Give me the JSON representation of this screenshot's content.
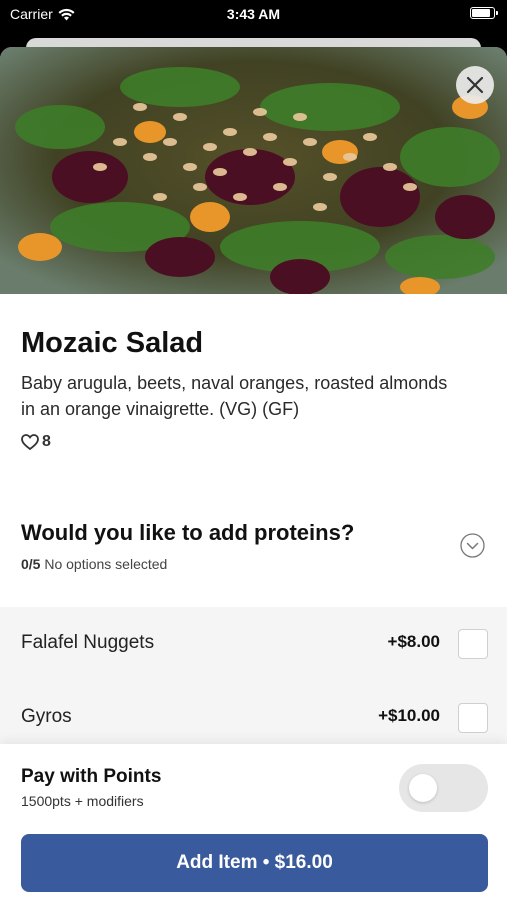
{
  "status_bar": {
    "carrier": "Carrier",
    "time": "3:43 AM"
  },
  "item": {
    "name": "Mozaic Salad",
    "description": "Baby arugula, beets, naval oranges, roasted almonds in an orange vinaigrette. (VG) (GF)",
    "likes": "8"
  },
  "proteins": {
    "title": "Would you like to add proteins?",
    "count": "0/5",
    "status": "No options selected",
    "options": [
      {
        "name": "Falafel Nuggets",
        "price": "+$8.00"
      },
      {
        "name": "Gyros",
        "price": "+$10.00"
      }
    ]
  },
  "points": {
    "title": "Pay with Points",
    "subtitle": "1500pts + modifiers"
  },
  "add_button": {
    "label": "Add Item • $16.00"
  },
  "colors": {
    "primary": "#3a5a9e",
    "toggle_off": "#e6e6e6"
  },
  "icons": [
    "wifi-icon",
    "battery-icon",
    "close-icon",
    "heart-icon",
    "chevron-down-icon"
  ]
}
